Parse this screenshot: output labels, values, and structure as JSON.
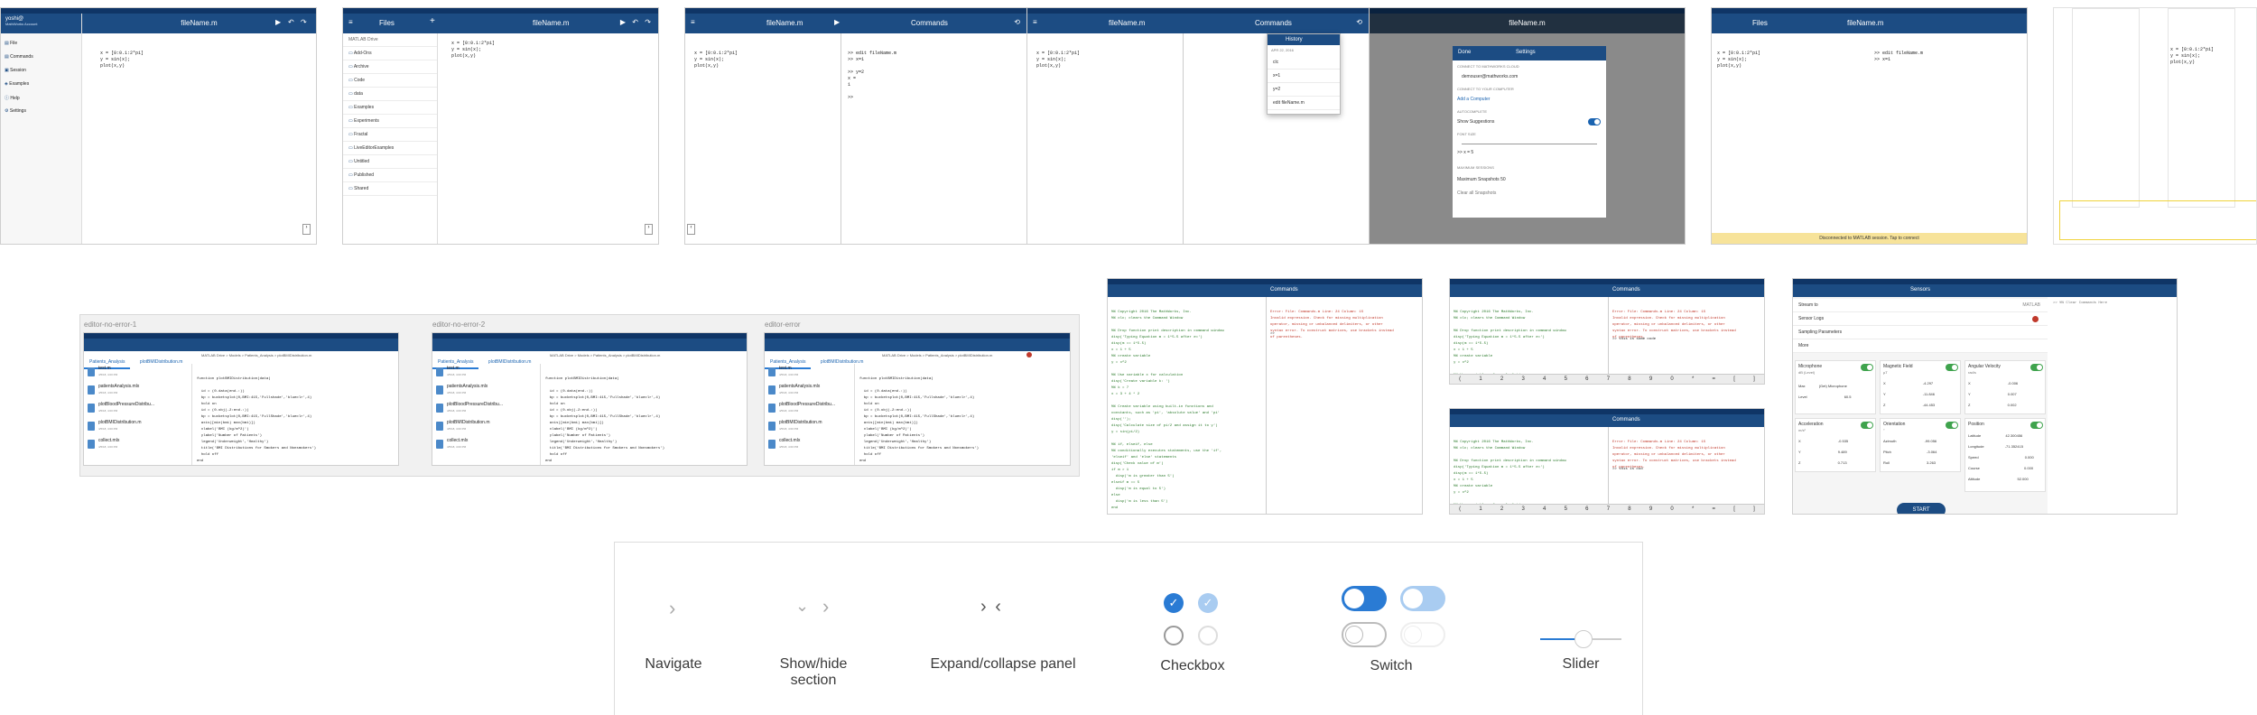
{
  "colors": {
    "accent": "#1c4c83",
    "status": "#0f3566",
    "switch": "#2a7bd4",
    "checkbox": "#2a7bd4",
    "banner": "#f7e39a",
    "error": "#c0392b",
    "key": "#7b2fb2"
  },
  "common": {
    "app_title": "fileName.m",
    "code_lines": [
      "x = [0:0.1:2*pi]",
      "y = sin(x);",
      "plot(x,y)"
    ],
    "prompt": ">>"
  },
  "s1": {
    "user": "yoshi@",
    "user_sub": "MathWorks Account",
    "menu": [
      "File",
      "Commands",
      "Session",
      "Examples",
      "Help",
      "Settings"
    ]
  },
  "s2": {
    "title": "Files",
    "drive": "MATLAB Drive",
    "folders": [
      "Add-Ons",
      "Archive",
      "Code",
      "data",
      "Examples",
      "Experiments",
      "Fractal",
      "LiveEditorExamples",
      "Untitled",
      "Published",
      "Shared"
    ]
  },
  "s3": {
    "title": "Commands",
    "cmds": [
      ">> edit fileName.m",
      ">> x=1",
      "",
      ">> y=2",
      "x =",
      "1",
      "",
      ">> "
    ]
  },
  "s4": {
    "title": "Commands",
    "history_title": "History",
    "history_date": "APR 22, 2016",
    "history": [
      "clc",
      "x=1",
      "y=2",
      "edit fileName.m"
    ]
  },
  "s5": {
    "done": "Done",
    "title": "Settings",
    "sections": [
      "CONNECT TO MATHWORKS CLOUD",
      "CONNECT TO YOUR COMPUTER",
      "AUTOCOMPLETE",
      "FONT SIZE",
      "MAXIMUM SESSIONS"
    ],
    "email": "demouser@mathworks.com",
    "add": "Add a Computer",
    "show_suggestions": "Show Suggestions",
    "font_sample": ">> x = 5",
    "max_label": "Maximum Snapshots 50",
    "clear": "Clear all Snapshots"
  },
  "s6": {
    "title": "Files",
    "cmd": ">> edit fileName.m",
    "cmd2": ">> x=1",
    "banner": "Disconnected to MATLAB session. Tap to connect"
  },
  "editors": [
    {
      "label": "editor-no-error-1",
      "tabs": [
        "Patients_Analysis",
        "plotBMIDistribution.m"
      ],
      "header": "MATLAB Drive > Models > Patients_Analysis > plotBMIDistribution.m",
      "files": [
        [
          "test.m",
          "4/5/18, 4:00 PM"
        ],
        [
          "patientsAnalysis.mlx",
          "4/5/18, 4:00 PM"
        ],
        [
          "plotBloodPressureDistribu...",
          "4/5/18, 4:00 PM"
        ],
        [
          "plotBMIDistribution.m",
          "4/5/18, 4:00 PM"
        ],
        [
          "collect.mlx",
          "4/5/18, 4:00 PM"
        ]
      ]
    },
    {
      "label": "editor-no-error-2",
      "tabs": [
        "Patients_Analysis",
        "plotBMIDistribution.m"
      ],
      "header": "MATLAB Drive > Models > Patients_Analysis > plotBMIDistribution.m",
      "files": [
        [
          "test.m",
          "4/5/18, 4:00 PM"
        ],
        [
          "patientsAnalysis.mlx",
          "4/5/18, 4:00 PM"
        ],
        [
          "plotBloodPressureDistribu...",
          "4/5/18, 4:00 PM"
        ],
        [
          "plotBMIDistribution.m",
          "4/5/18, 4:00 PM"
        ],
        [
          "collect.mlx",
          "4/5/18, 4:00 PM"
        ]
      ]
    },
    {
      "label": "editor-error",
      "tabs": [
        "Patients_Analysis",
        "plotBMIDistribution.m"
      ],
      "header": "MATLAB Drive > Models > Patients_Analysis > plotBMIDistribution.m",
      "files": [
        [
          "test.m",
          "4/5/18, 4:00 PM"
        ],
        [
          "patientsAnalysis.mlx",
          "4/5/18, 4:00 PM"
        ],
        [
          "plotBloodPressureDistribu...",
          "4/5/18, 4:00 PM"
        ],
        [
          "plotBMIDistribution.m",
          "4/5/18, 4:00 PM"
        ],
        [
          "collect.mlx",
          "4/5/18, 4:00 PM"
        ]
      ]
    }
  ],
  "editor_code": [
    "function plotBMIDistribution(data)",
    "",
    "  id = (0.data(end.:))",
    "  bp = bucketsplot(0,BMI:415,'Fullshade','blueclr',4)",
    "  hold on",
    "  id = (0.obj(-2:end.:))",
    "  bp = bucketsplot(0,BMI:415,'FullShade','blueclr',4)",
    "  axis([min(bmi) max(bmi)])",
    "  xlabel('BMI (kg/m^2)')",
    "  ylabel('Number of Patients')",
    "  legend('Underweight','Healthy')",
    "  title('BMI Distributions for Smokers and Nonsmokers')",
    "  hold off",
    "end"
  ],
  "ph1": {
    "title": "Commands",
    "code": [
      "%% Copyright 2016 The MathWorks, Inc.",
      "%% clc; clears the Command Window",
      "",
      "%% Drop function print description in command window",
      "disp('Typing Equation m = 1*5.5 after e=')",
      "disp(m == 1*5.5)",
      "x = 1 + 5",
      "%% create variable",
      "y = x^2",
      "",
      "%% Use variable x for calculation",
      "disp('Create variable k: ')",
      "%% k = 7",
      "x = 3 + 4 * 2",
      "",
      "%% Create variable using built-in functions and",
      "constants, such as 'pi', 'absolute value' and 'pi'",
      "disp('');",
      "disp('Calculate size of pi/2 and assign it to y')",
      "y = sin(pi/2)",
      "",
      "%% if, elseif, else",
      "%% conditionally executes statements, use the 'if',",
      "'elseif' and 'else' statements",
      "disp('Check value of m')",
      "if m > 1",
      "  disp('m is greater than 5')",
      "elseif m == 5",
      "  disp('m is equal to 5')",
      "else",
      "  disp('m is less than 5')",
      "end"
    ],
    "err": [
      "Error: File: Commands.m Line: 24 Column: 15",
      "Invalid expression. Check for missing multiplication",
      "operator, missing or unbalanced delimiters, or other",
      "syntax error. To construct matrices, use brackets instead",
      "of parentheses."
    ]
  },
  "ph2": {
    "title": "Commands",
    "code": [
      "%% Copyright 2016 The MathWorks, Inc.",
      "%% clc; clears the Command Window",
      "",
      "%% Drop function print description in command window",
      "disp('Typing Equation m = 1*5.5 after e=')",
      "disp(m == 1*5.5)",
      "x = 1 + 5",
      "%% create variable",
      "y = x^2",
      "",
      "%% Use variable x for calculation"
    ],
    "err": [
      "Error: File: Commands.m Line: 24 Column: 15",
      "Invalid expression. Check for missing multiplication",
      "operator, missing or unbalanced delimiters, or other",
      "syntax error. To construct matrices, use brackets instead",
      "of parentheses."
    ],
    "input": ">> this is some code",
    "keys": [
      "(",
      "1",
      "2",
      "3",
      "4",
      "5",
      "6",
      "7",
      "8",
      "9",
      "0",
      "*",
      "=",
      "[",
      "]"
    ]
  },
  "ph3": {
    "title": "Commands",
    "input": ">> this is cod"
  },
  "sensors": {
    "title": "Sensors",
    "stream": "Stream to",
    "stream_val": "MATLAB",
    "sensor_log": "Sensor Logs",
    "sampling": "Sampling Parameters",
    "more": "More",
    "cards": [
      {
        "name": "Microphone",
        "unit": "dB (Level)",
        "rows": [
          [
            "Max",
            "(Get) Microphone"
          ],
          [
            "Level",
            "60.5"
          ]
        ]
      },
      {
        "name": "Magnetic Field",
        "unit": "µT",
        "rows": [
          [
            "X",
            "-4.297"
          ],
          [
            "Y",
            "-11.846"
          ],
          [
            "Z",
            "-44.453"
          ]
        ]
      },
      {
        "name": "Angular Velocity",
        "unit": "rad/s",
        "rows": [
          [
            "X",
            "-0.006"
          ],
          [
            "Y",
            "0.007"
          ],
          [
            "Z",
            "0.002"
          ]
        ]
      },
      {
        "name": "Acceleration",
        "unit": "m/s²",
        "rows": [
          [
            "X",
            "-0.535"
          ],
          [
            "Y",
            "9.489"
          ],
          [
            "Z",
            "0.713"
          ]
        ]
      },
      {
        "name": "Orientation",
        "unit": "°",
        "rows": [
          [
            "Azimuth",
            "-99.056"
          ],
          [
            "Pitch",
            "-3.064"
          ],
          [
            "Roll",
            "3.263"
          ]
        ]
      },
      {
        "name": "Position",
        "unit": "",
        "rows": [
          [
            "Latitude",
            "42.300456"
          ],
          [
            "Longitude",
            "-71.352415"
          ],
          [
            "Speed",
            "0.000"
          ],
          [
            "Course",
            "0.000"
          ],
          [
            "Altitude",
            "52.000"
          ]
        ]
      }
    ],
    "start": "START",
    "side": ">> %% Clear Commands Here"
  },
  "legend": {
    "items": [
      "Navigate",
      "Show/hide section",
      "Expand/collapse panel",
      "Checkbox",
      "Switch",
      "Slider"
    ]
  }
}
